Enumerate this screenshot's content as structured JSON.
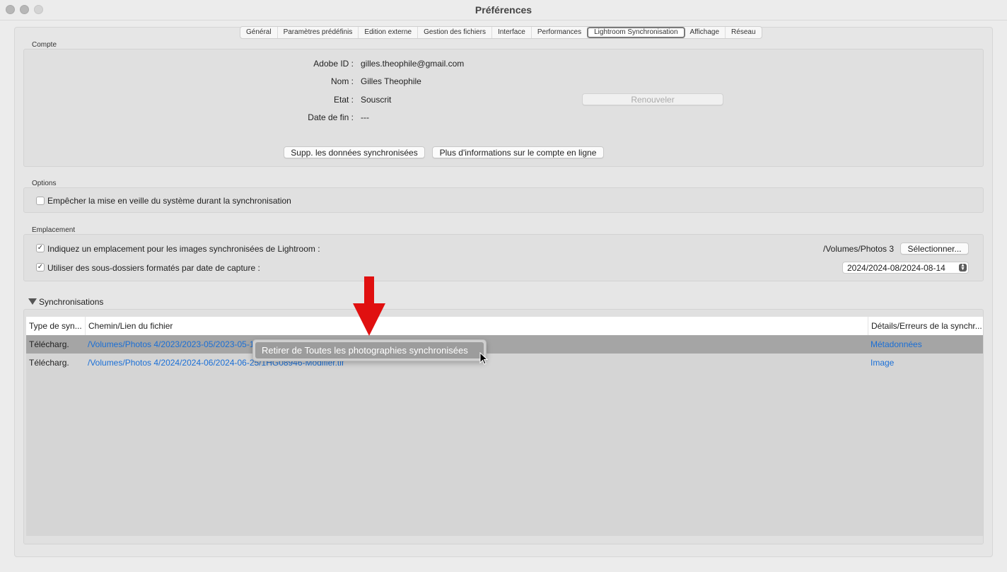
{
  "window": {
    "title": "Préférences"
  },
  "tabs": [
    {
      "label": "Général"
    },
    {
      "label": "Paramètres prédéfinis"
    },
    {
      "label": "Edition externe"
    },
    {
      "label": "Gestion des fichiers"
    },
    {
      "label": "Interface"
    },
    {
      "label": "Performances"
    },
    {
      "label": "Lightroom Synchronisation",
      "active": true
    },
    {
      "label": "Affichage"
    },
    {
      "label": "Réseau"
    }
  ],
  "account": {
    "section_label": "Compte",
    "adobe_id_label": "Adobe ID :",
    "adobe_id_value": "gilles.theophile@gmail.com",
    "name_label": "Nom :",
    "name_value": "Gilles Theophile",
    "state_label": "Etat :",
    "state_value": "Souscrit",
    "renew_button": "Renouveler",
    "end_date_label": "Date de fin :",
    "end_date_value": "---",
    "delete_button": "Supp. les données synchronisées",
    "more_info_button": "Plus d'informations sur le compte en ligne"
  },
  "options": {
    "section_label": "Options",
    "prevent_sleep_label": "Empêcher la mise en veille du système durant la synchronisation",
    "prevent_sleep_checked": false
  },
  "location": {
    "section_label": "Emplacement",
    "specify_location_label": "Indiquez un emplacement pour les images synchronisées de Lightroom :",
    "specify_location_checked": true,
    "path_value": "/Volumes/Photos 3",
    "select_button": "Sélectionner...",
    "subfolders_label": "Utiliser des sous-dossiers formatés par date de capture :",
    "subfolders_checked": true,
    "date_format_value": "2024/2024-08/2024-08-14"
  },
  "syncs": {
    "section_label": "Synchronisations",
    "columns": [
      "Type de syn...",
      "Chemin/Lien du fichier",
      "Détails/Erreurs de la synchr..."
    ],
    "rows": [
      {
        "type": "Télécharg.",
        "path": "/Volumes/Photos 4/2023/2023-05/2023-05-19/T",
        "details": "Métadonnées"
      },
      {
        "type": "Télécharg.",
        "path": "/Volumes/Photos 4/2024/2024-06/2024-06-25/",
        "path_tail": "1HG08946-Modifier.tif",
        "details": "Image"
      }
    ]
  },
  "context_menu": {
    "item": "Retirer de Toutes les photographies synchronisées"
  },
  "colors": {
    "link": "#1a6fd6",
    "annotation_arrow": "#e01010"
  }
}
